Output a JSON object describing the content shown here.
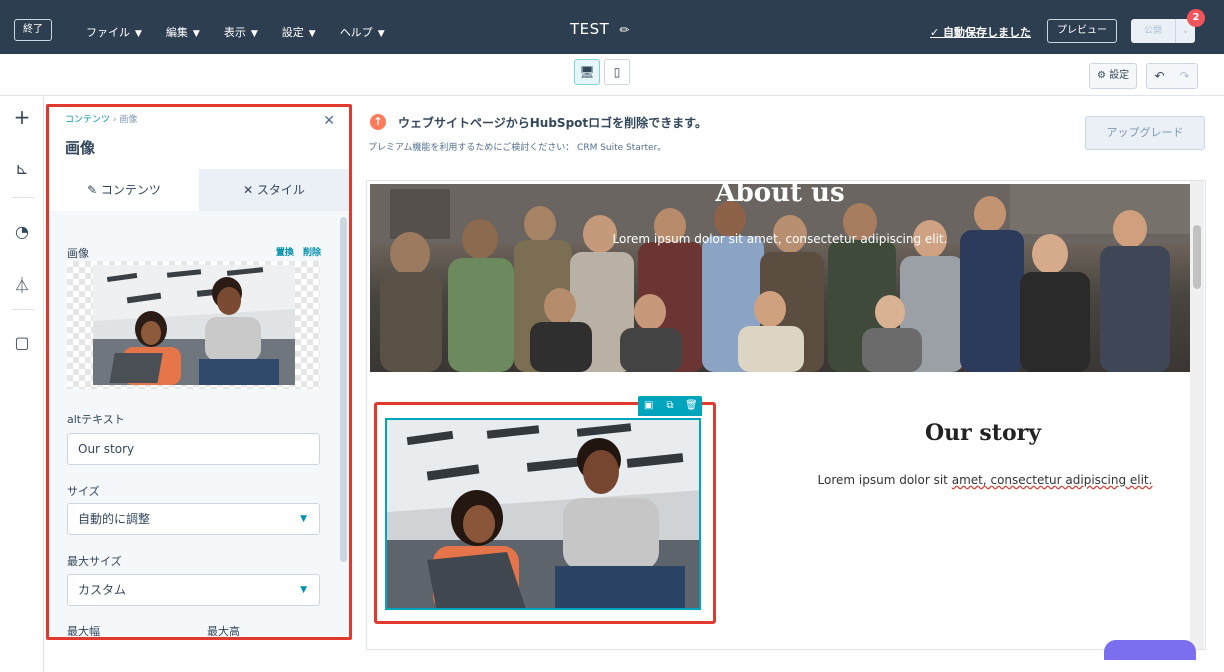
{
  "topbar": {
    "exit_label": "終了",
    "menus": [
      {
        "label": "ファイル"
      },
      {
        "label": "編集"
      },
      {
        "label": "表示"
      },
      {
        "label": "設定"
      },
      {
        "label": "ヘルプ"
      }
    ],
    "page_title": "TEST",
    "autosave": "✓ 自動保存しました",
    "preview_label": "プレビュー",
    "publish_label": "公開",
    "notification_count": "2"
  },
  "toolbar": {
    "settings_label": "⚙ 設定"
  },
  "sidebar": {
    "breadcrumb_root": "コンテンツ",
    "breadcrumb_sep": "›",
    "breadcrumb_current": "画像",
    "title": "画像",
    "tabs": [
      {
        "label": "✎ コンテンツ",
        "active": true
      },
      {
        "label": "✕ スタイル",
        "active": false
      }
    ],
    "image_label": "画像",
    "replace_link": "置換",
    "delete_link": "削除",
    "alt_label": "altテキスト",
    "alt_value": "Our story",
    "size_label": "サイズ",
    "size_value": "自動的に調整",
    "max_size_label": "最大サイズ",
    "max_size_value": "カスタム",
    "max_width_label": "最大幅",
    "max_height_label": "最大高"
  },
  "promo": {
    "title": "ウェブサイトページからHubSpotロゴを削除できます。",
    "subtitle": "プレミアム機能を利用するためにご検討ください： CRM Suite Starter。",
    "upgrade_label": "アップグレード"
  },
  "page": {
    "hero_title": "About us",
    "hero_subtitle": "Lorem ipsum dolor sit amet, consectetur adipiscing elit.",
    "story_title": "Our story",
    "story_text_plain": "Lorem ipsum dolor sit ",
    "story_text_squiggle": "amet, consectetur adipiscing elit."
  },
  "colors": {
    "topbar": "#2d3e50",
    "accent": "#00a4bd",
    "highlight": "#e0392e",
    "promo_icon": "#ff7a59"
  }
}
